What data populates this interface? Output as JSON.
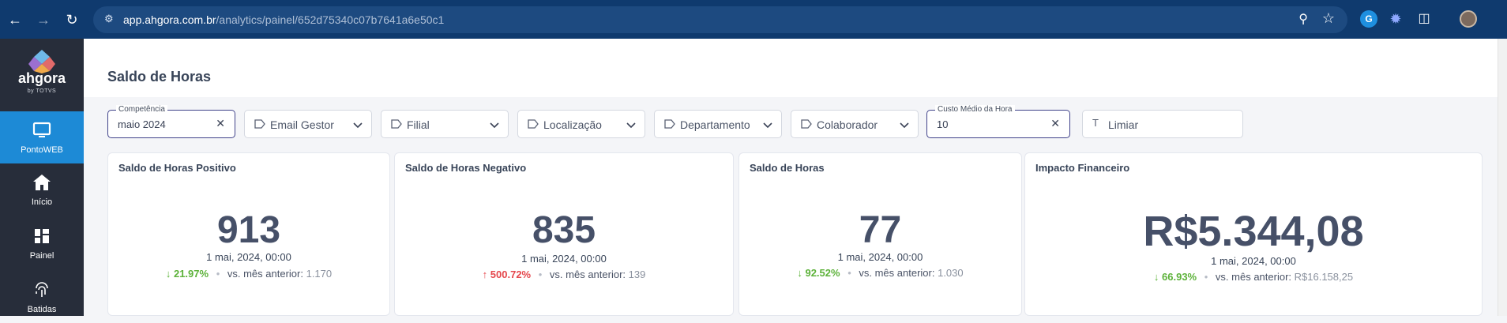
{
  "browser": {
    "url_host": "app.ahgora.com.br",
    "url_path": "/analytics/painel/652d75340c07b7641a6e50c1"
  },
  "sidebar": {
    "brand": "ahgora",
    "brand_sub": "by TOTVS",
    "items": [
      {
        "label": "PontoWEB",
        "icon": "monitor-icon",
        "active": true
      },
      {
        "label": "Início",
        "icon": "home-icon",
        "active": false
      },
      {
        "label": "Painel",
        "icon": "dashboard-icon",
        "active": false
      },
      {
        "label": "Batidas",
        "icon": "fingerprint-icon",
        "active": false
      }
    ]
  },
  "page": {
    "title": "Saldo de Horas"
  },
  "filters": {
    "competencia": {
      "label": "Competência",
      "value": "maio 2024"
    },
    "email_gestor": {
      "placeholder": "Email Gestor"
    },
    "filial": {
      "placeholder": "Filial"
    },
    "localizacao": {
      "placeholder": "Localização"
    },
    "departamento": {
      "placeholder": "Departamento"
    },
    "colaborador": {
      "placeholder": "Colaborador"
    },
    "custo_medio": {
      "label": "Custo Médio da Hora",
      "value": "10"
    },
    "limiar": {
      "placeholder": "Limiar"
    }
  },
  "cards": [
    {
      "title": "Saldo de Horas Positivo",
      "value": "913",
      "date": "1 mai, 2024, 00:00",
      "pct": "21.97%",
      "trend": "down",
      "prev_label": "vs. mês anterior:",
      "prev_value": "1.170"
    },
    {
      "title": "Saldo de Horas Negativo",
      "value": "835",
      "date": "1 mai, 2024, 00:00",
      "pct": "500.72%",
      "trend": "up",
      "prev_label": "vs. mês anterior:",
      "prev_value": "139"
    },
    {
      "title": "Saldo de Horas",
      "value": "77",
      "date": "1 mai, 2024, 00:00",
      "pct": "92.52%",
      "trend": "down",
      "prev_label": "vs. mês anterior:",
      "prev_value": "1.030"
    },
    {
      "title": "Impacto Financeiro",
      "value": "R$5.344,08",
      "date": "1 mai, 2024, 00:00",
      "pct": "66.93%",
      "trend": "down",
      "prev_label": "vs. mês anterior:",
      "prev_value": "R$16.158,25"
    }
  ],
  "colors": {
    "chrome": "#0f3a6e",
    "sidebar": "#272d3a",
    "sidebar_active": "#1d8ad6",
    "positive": "#5db23a",
    "negative": "#e5484d"
  }
}
